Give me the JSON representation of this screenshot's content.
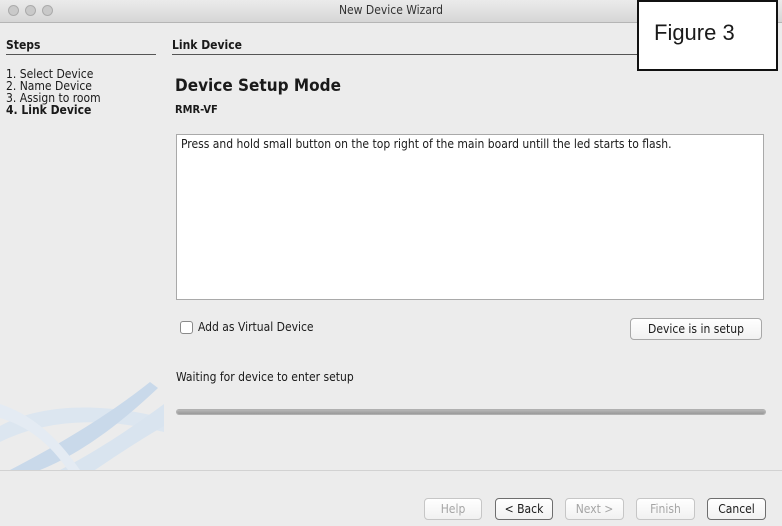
{
  "window": {
    "title": "New Device Wizard"
  },
  "sidebar": {
    "heading": "Steps",
    "steps": [
      "1.  Select Device",
      "2.  Name Device",
      "3.  Assign to room",
      "4.  Link Device"
    ],
    "current_index": 3
  },
  "main": {
    "heading": "Link Device",
    "title": "Device Setup Mode",
    "device_name": "RMR-VF",
    "instructions": "Press and hold small button on the top right of the main board untill the led starts to flash.",
    "virtual_checkbox": {
      "label": "Add as Virtual Device",
      "checked": false
    },
    "setup_button": "Device is in setup",
    "status_text": "Waiting for device to enter setup",
    "progress": 1.0
  },
  "footer": {
    "help": "Help",
    "back": "< Back",
    "next": "Next >",
    "finish": "Finish",
    "cancel": "Cancel"
  },
  "overlay": {
    "figure_label": "Figure 3"
  }
}
